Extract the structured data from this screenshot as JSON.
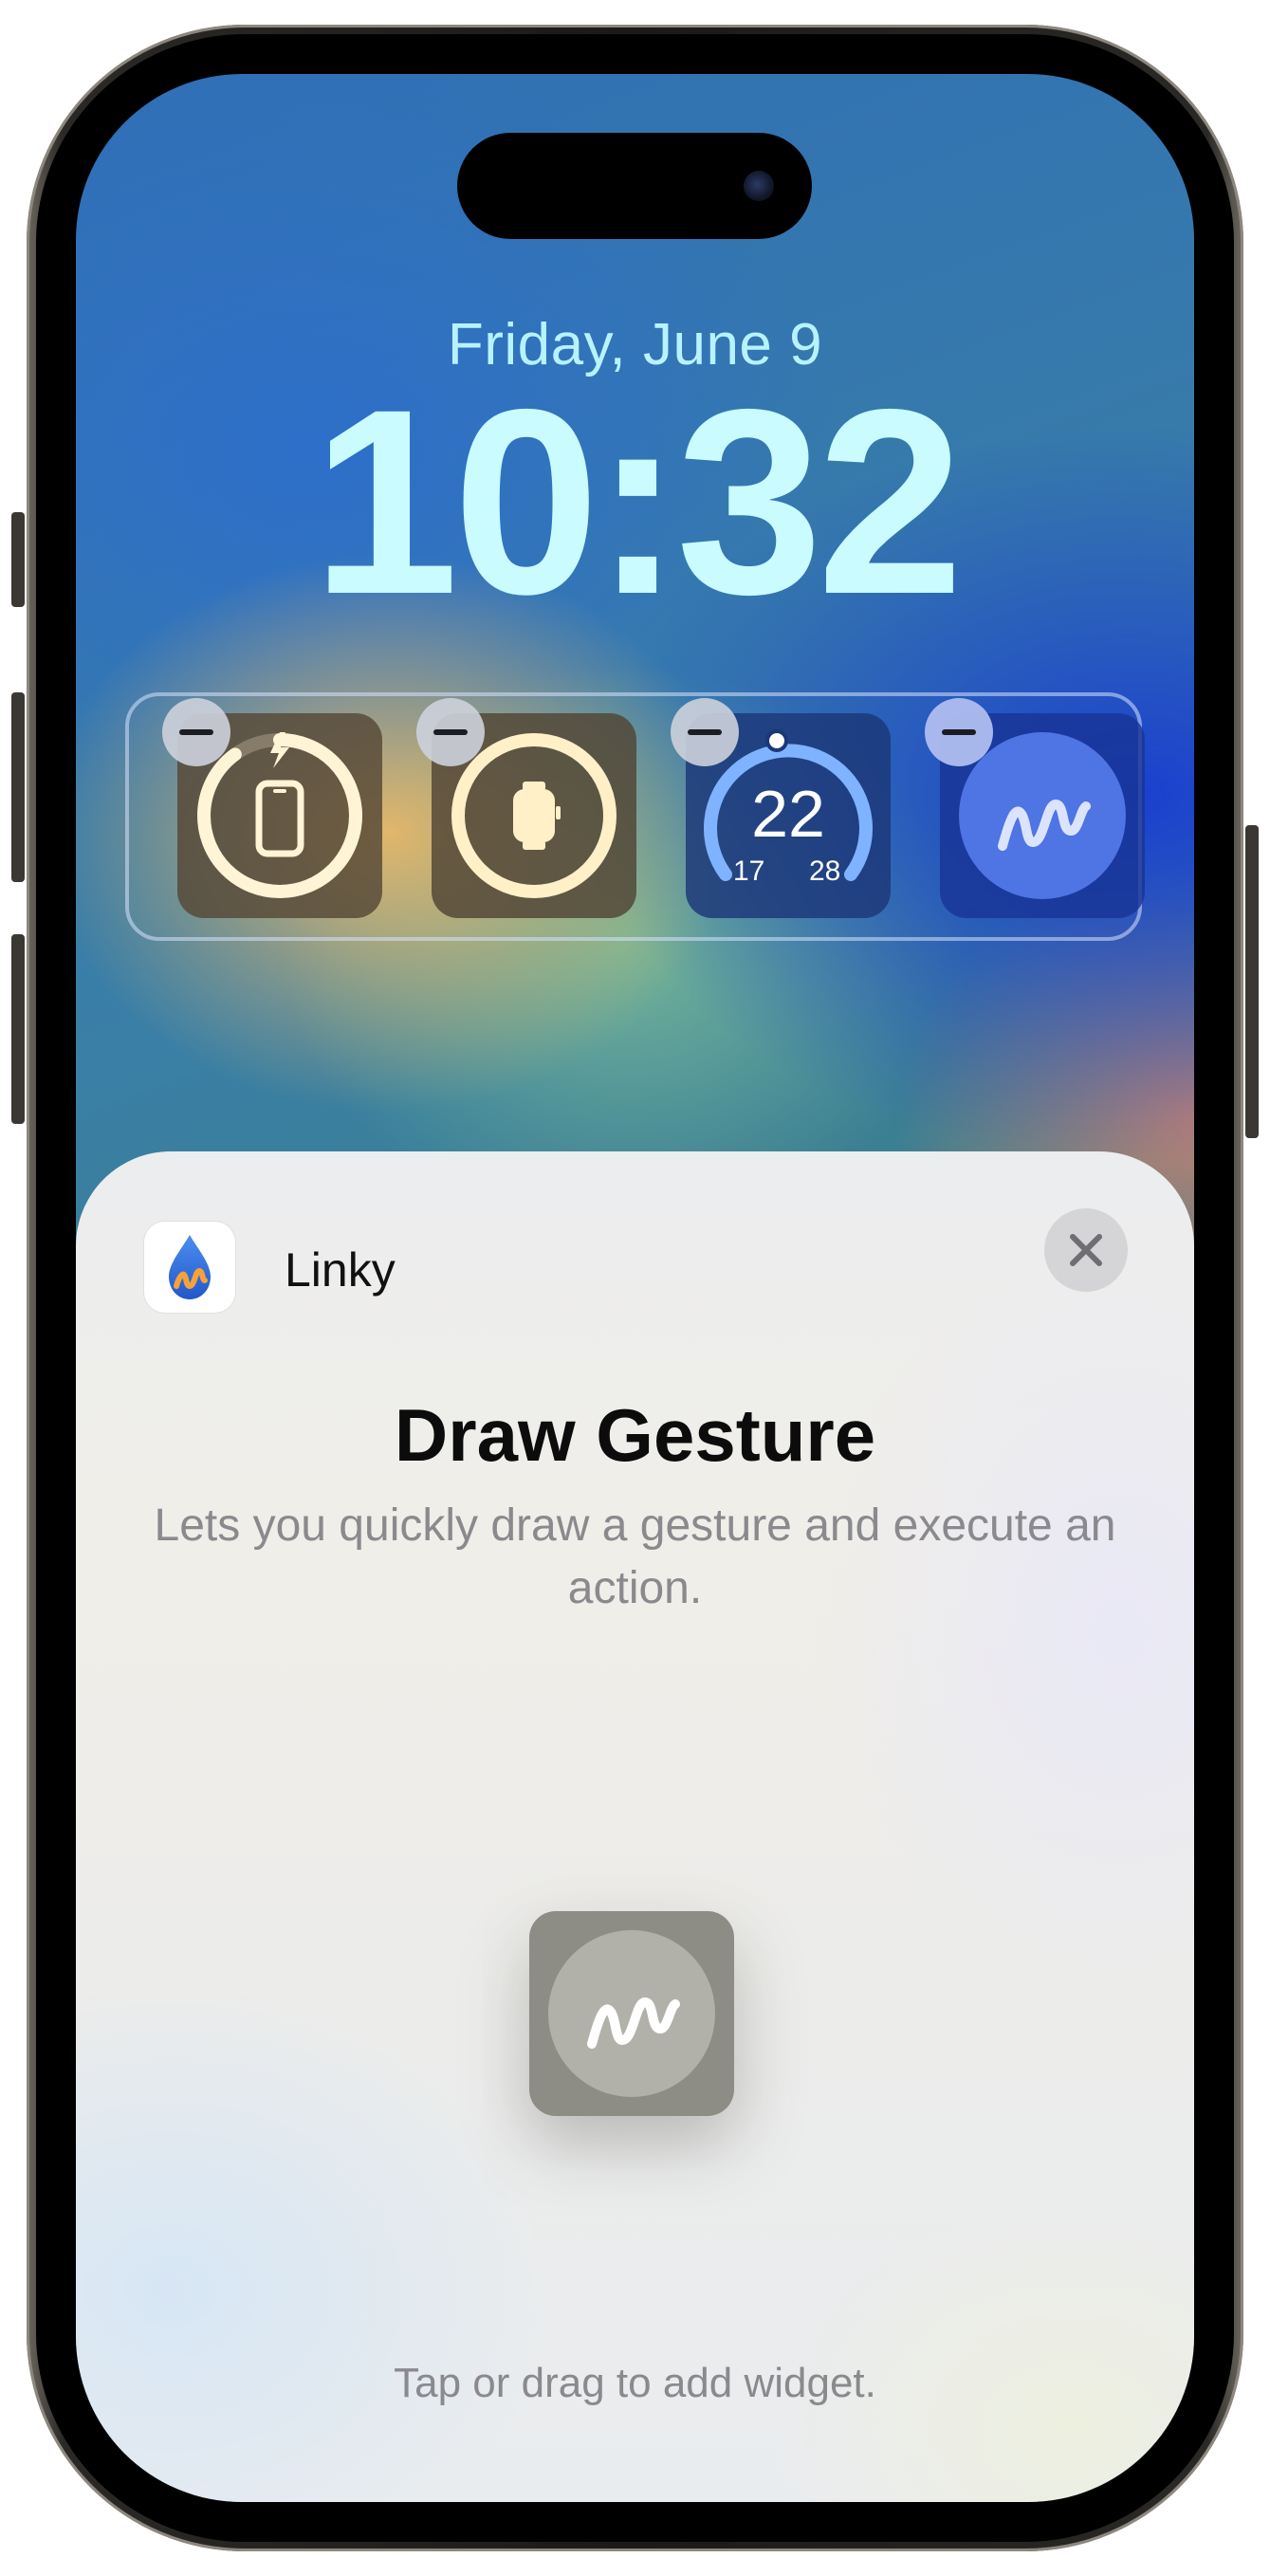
{
  "lock_screen": {
    "date": "Friday, June 9",
    "time": "10:32"
  },
  "widgets": [
    {
      "name": "iPhone battery",
      "icon": "iphone-charging-icon",
      "level": 0.9
    },
    {
      "name": "Apple Watch battery",
      "icon": "apple-watch-icon",
      "level": 1.0
    },
    {
      "name": "Temperature",
      "current": "22",
      "low": "17",
      "high": "28"
    },
    {
      "name": "Draw Gesture",
      "icon": "gesture-squiggle-icon"
    }
  ],
  "sheet": {
    "app_name": "Linky",
    "app_icon": "linky-drop-icon",
    "close_icon": "close-icon",
    "title": "Draw Gesture",
    "description": "Lets you quickly draw a gesture and execute an action.",
    "preview_icon": "gesture-squiggle-icon",
    "hint": "Tap or drag to add widget."
  },
  "colors": {
    "date_text": "#b7f3ff",
    "time_text": "#c9fbff",
    "gesture_widget_bg": "#1e3ea0",
    "gesture_circle": "#4f74e4",
    "preview_bg": "#8e8d85"
  }
}
